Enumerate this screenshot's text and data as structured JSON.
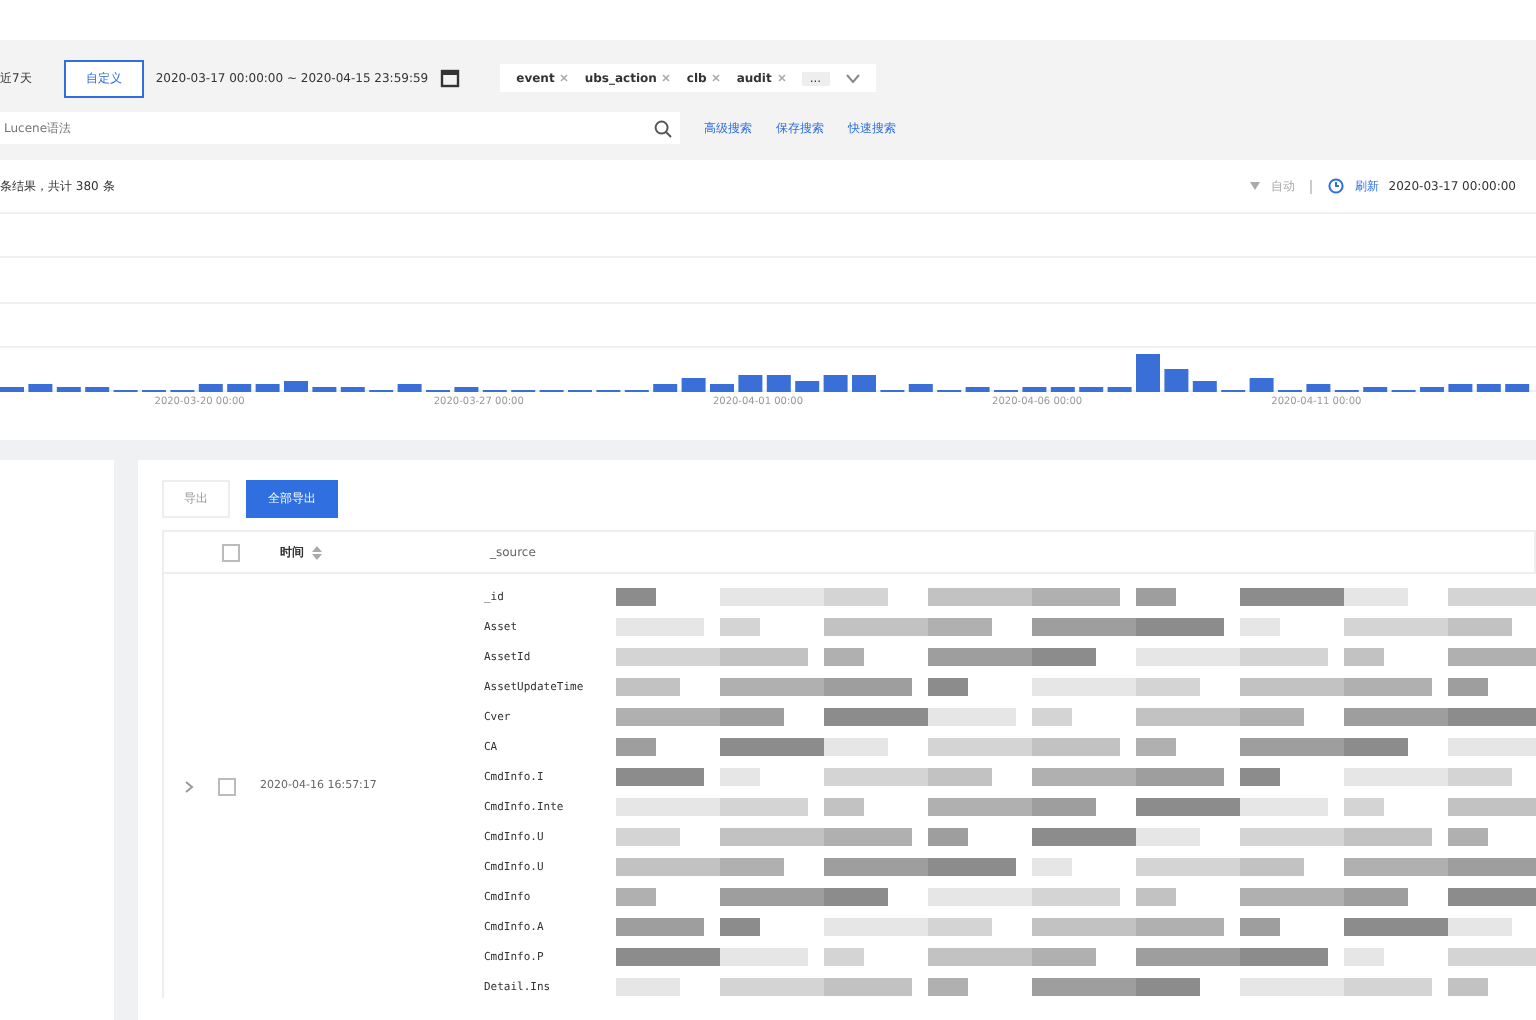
{
  "filters": {
    "range_label": "近7天",
    "custom_button": "自定义",
    "date_range": "2020-03-17 00:00:00 ~ 2020-04-15 23:59:59",
    "tags": [
      {
        "label": "event"
      },
      {
        "label": "ubs_action"
      },
      {
        "label": "clb"
      },
      {
        "label": "audit"
      }
    ],
    "more": "..."
  },
  "search": {
    "placeholder": "Lucene语法",
    "links": [
      "高级搜索",
      "保存搜索",
      "快速搜索"
    ]
  },
  "histogram": {
    "summary": "条结果，共计 380 条",
    "interval": "自动",
    "refresh": "刷新",
    "start": "2020-03-17 00:00:00",
    "x_labels": [
      "2020-03-20 00:00",
      "2020-03-27 00:00",
      "2020-04-01 00:00",
      "2020-04-06 00:00",
      "2020-04-11 00:00"
    ]
  },
  "table": {
    "select_all_checked": false,
    "buttons": [
      {
        "label": "导出",
        "primary": false
      },
      {
        "label": "全部导出",
        "primary": true
      }
    ],
    "columns": [
      "时间",
      "_source"
    ],
    "rows": [
      {
        "expanded": false,
        "checked": false,
        "time": "2020-04-16 16:57:17",
        "fields": [
          "_id",
          "Asset",
          "AssetId",
          "AssetUpdateTime",
          "Cver",
          "CA",
          "CmdInfo.I",
          "CmdInfo.Inte",
          "CmdInfo.U",
          "CmdInfo.U",
          "CmdInfo",
          "CmdInfo.A",
          "CmdInfo.P",
          "Detail.Ins"
        ]
      }
    ]
  }
}
